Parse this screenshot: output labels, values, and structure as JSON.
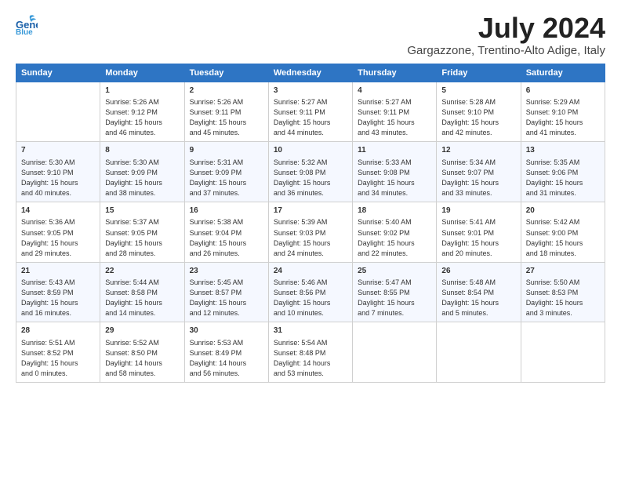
{
  "logo": {
    "line1": "General",
    "line2": "Blue"
  },
  "header": {
    "title": "July 2024",
    "subtitle": "Gargazzone, Trentino-Alto Adige, Italy"
  },
  "columns": [
    "Sunday",
    "Monday",
    "Tuesday",
    "Wednesday",
    "Thursday",
    "Friday",
    "Saturday"
  ],
  "weeks": [
    [
      {
        "day": "",
        "text": ""
      },
      {
        "day": "1",
        "text": "Sunrise: 5:26 AM\nSunset: 9:12 PM\nDaylight: 15 hours\nand 46 minutes."
      },
      {
        "day": "2",
        "text": "Sunrise: 5:26 AM\nSunset: 9:11 PM\nDaylight: 15 hours\nand 45 minutes."
      },
      {
        "day": "3",
        "text": "Sunrise: 5:27 AM\nSunset: 9:11 PM\nDaylight: 15 hours\nand 44 minutes."
      },
      {
        "day": "4",
        "text": "Sunrise: 5:27 AM\nSunset: 9:11 PM\nDaylight: 15 hours\nand 43 minutes."
      },
      {
        "day": "5",
        "text": "Sunrise: 5:28 AM\nSunset: 9:10 PM\nDaylight: 15 hours\nand 42 minutes."
      },
      {
        "day": "6",
        "text": "Sunrise: 5:29 AM\nSunset: 9:10 PM\nDaylight: 15 hours\nand 41 minutes."
      }
    ],
    [
      {
        "day": "7",
        "text": "Sunrise: 5:30 AM\nSunset: 9:10 PM\nDaylight: 15 hours\nand 40 minutes."
      },
      {
        "day": "8",
        "text": "Sunrise: 5:30 AM\nSunset: 9:09 PM\nDaylight: 15 hours\nand 38 minutes."
      },
      {
        "day": "9",
        "text": "Sunrise: 5:31 AM\nSunset: 9:09 PM\nDaylight: 15 hours\nand 37 minutes."
      },
      {
        "day": "10",
        "text": "Sunrise: 5:32 AM\nSunset: 9:08 PM\nDaylight: 15 hours\nand 36 minutes."
      },
      {
        "day": "11",
        "text": "Sunrise: 5:33 AM\nSunset: 9:08 PM\nDaylight: 15 hours\nand 34 minutes."
      },
      {
        "day": "12",
        "text": "Sunrise: 5:34 AM\nSunset: 9:07 PM\nDaylight: 15 hours\nand 33 minutes."
      },
      {
        "day": "13",
        "text": "Sunrise: 5:35 AM\nSunset: 9:06 PM\nDaylight: 15 hours\nand 31 minutes."
      }
    ],
    [
      {
        "day": "14",
        "text": "Sunrise: 5:36 AM\nSunset: 9:05 PM\nDaylight: 15 hours\nand 29 minutes."
      },
      {
        "day": "15",
        "text": "Sunrise: 5:37 AM\nSunset: 9:05 PM\nDaylight: 15 hours\nand 28 minutes."
      },
      {
        "day": "16",
        "text": "Sunrise: 5:38 AM\nSunset: 9:04 PM\nDaylight: 15 hours\nand 26 minutes."
      },
      {
        "day": "17",
        "text": "Sunrise: 5:39 AM\nSunset: 9:03 PM\nDaylight: 15 hours\nand 24 minutes."
      },
      {
        "day": "18",
        "text": "Sunrise: 5:40 AM\nSunset: 9:02 PM\nDaylight: 15 hours\nand 22 minutes."
      },
      {
        "day": "19",
        "text": "Sunrise: 5:41 AM\nSunset: 9:01 PM\nDaylight: 15 hours\nand 20 minutes."
      },
      {
        "day": "20",
        "text": "Sunrise: 5:42 AM\nSunset: 9:00 PM\nDaylight: 15 hours\nand 18 minutes."
      }
    ],
    [
      {
        "day": "21",
        "text": "Sunrise: 5:43 AM\nSunset: 8:59 PM\nDaylight: 15 hours\nand 16 minutes."
      },
      {
        "day": "22",
        "text": "Sunrise: 5:44 AM\nSunset: 8:58 PM\nDaylight: 15 hours\nand 14 minutes."
      },
      {
        "day": "23",
        "text": "Sunrise: 5:45 AM\nSunset: 8:57 PM\nDaylight: 15 hours\nand 12 minutes."
      },
      {
        "day": "24",
        "text": "Sunrise: 5:46 AM\nSunset: 8:56 PM\nDaylight: 15 hours\nand 10 minutes."
      },
      {
        "day": "25",
        "text": "Sunrise: 5:47 AM\nSunset: 8:55 PM\nDaylight: 15 hours\nand 7 minutes."
      },
      {
        "day": "26",
        "text": "Sunrise: 5:48 AM\nSunset: 8:54 PM\nDaylight: 15 hours\nand 5 minutes."
      },
      {
        "day": "27",
        "text": "Sunrise: 5:50 AM\nSunset: 8:53 PM\nDaylight: 15 hours\nand 3 minutes."
      }
    ],
    [
      {
        "day": "28",
        "text": "Sunrise: 5:51 AM\nSunset: 8:52 PM\nDaylight: 15 hours\nand 0 minutes."
      },
      {
        "day": "29",
        "text": "Sunrise: 5:52 AM\nSunset: 8:50 PM\nDaylight: 14 hours\nand 58 minutes."
      },
      {
        "day": "30",
        "text": "Sunrise: 5:53 AM\nSunset: 8:49 PM\nDaylight: 14 hours\nand 56 minutes."
      },
      {
        "day": "31",
        "text": "Sunrise: 5:54 AM\nSunset: 8:48 PM\nDaylight: 14 hours\nand 53 minutes."
      },
      {
        "day": "",
        "text": ""
      },
      {
        "day": "",
        "text": ""
      },
      {
        "day": "",
        "text": ""
      }
    ]
  ]
}
